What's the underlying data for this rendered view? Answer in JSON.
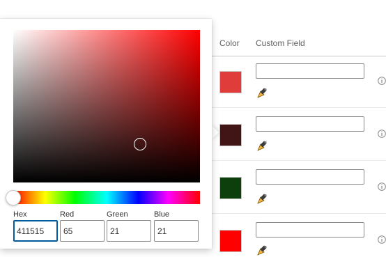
{
  "table": {
    "headers": {
      "color": "Color",
      "custom_field": "Custom Field"
    },
    "rows": [
      {
        "color": "#e03c3c",
        "custom_field_value": ""
      },
      {
        "color": "#411515",
        "custom_field_value": ""
      },
      {
        "color": "#0d3f0d",
        "custom_field_value": ""
      },
      {
        "color": "#ff0000",
        "custom_field_value": ""
      }
    ]
  },
  "color_picker": {
    "hue_color": "#ff0000",
    "saturation": 0.68,
    "value": 0.25,
    "hue": 0,
    "fields": {
      "hex": {
        "label": "Hex",
        "value": "411515"
      },
      "red": {
        "label": "Red",
        "value": "65"
      },
      "green": {
        "label": "Green",
        "value": "21"
      },
      "blue": {
        "label": "Blue",
        "value": "21"
      }
    }
  },
  "icons": {
    "edit": "paint-brush-icon",
    "info": "info-icon"
  }
}
